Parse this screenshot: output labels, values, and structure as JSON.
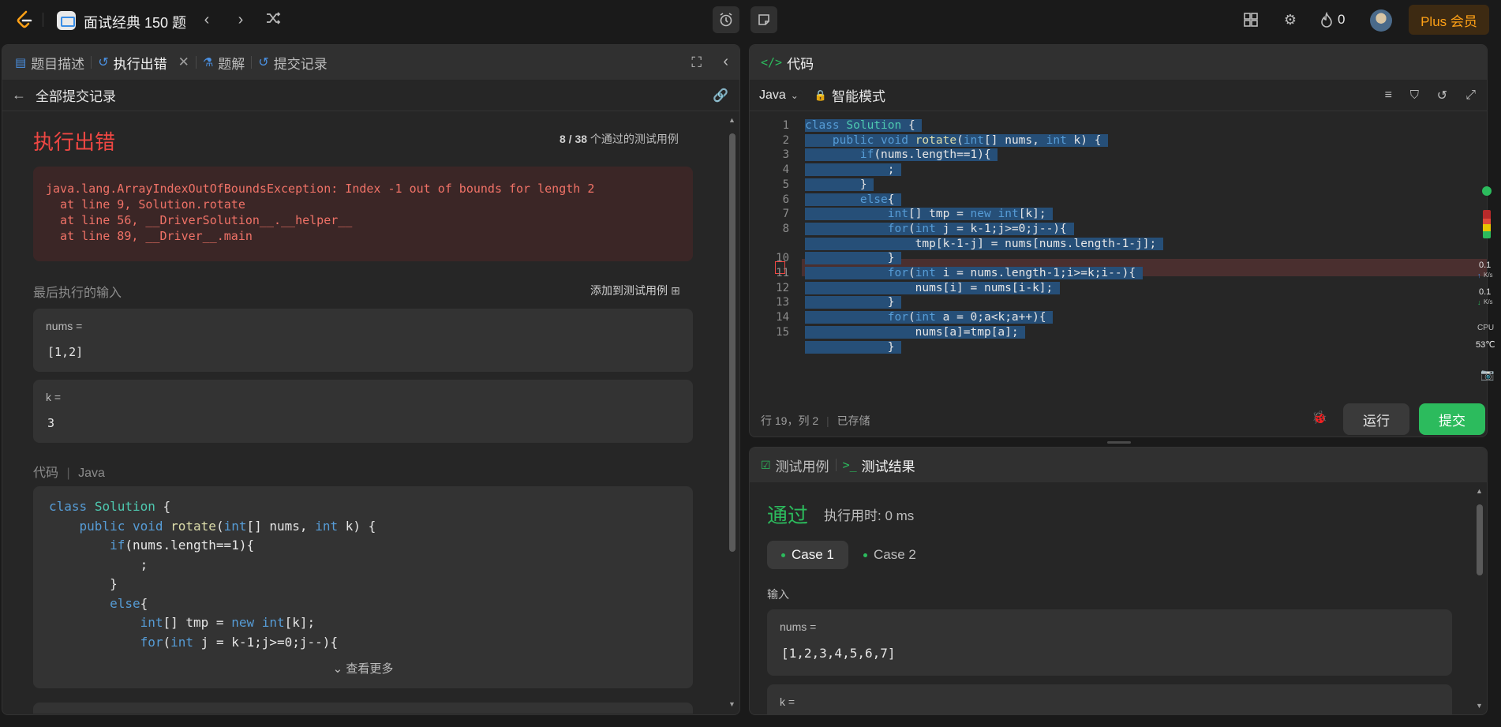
{
  "topbar": {
    "problem_list_title": "面试经典 150 题",
    "streak_count": "0",
    "plus_label": "Plus 会员"
  },
  "left_panel": {
    "tabs": [
      {
        "label": "题目描述",
        "icon": "description-icon"
      },
      {
        "label": "执行出错",
        "icon": "history-icon",
        "active": true
      },
      {
        "label": "题解",
        "icon": "flask-icon"
      },
      {
        "label": "提交记录",
        "icon": "history-icon"
      }
    ],
    "back_label": "全部提交记录",
    "status_title": "执行出错",
    "passed_count": "8 / 38",
    "passed_suffix": "个通过的测试用例",
    "error_message": "java.lang.ArrayIndexOutOfBoundsException: Index -1 out of bounds for length 2\n  at line 9, Solution.rotate\n  at line 56, __DriverSolution__.__helper__\n  at line 89, __Driver__.main",
    "last_input_label": "最后执行的输入",
    "add_testcase_label": "添加到测试用例",
    "inputs": [
      {
        "name": "nums =",
        "value": "[1,2]"
      },
      {
        "name": "k =",
        "value": "3"
      }
    ],
    "code_label": "代码",
    "code_lang": "Java",
    "see_more_label": "查看更多"
  },
  "editor": {
    "title": "代码",
    "language": "Java",
    "mode_label": "智能模式",
    "cursor_pos": "行 19，列 2",
    "save_status": "已存储",
    "run_label": "运行",
    "submit_label": "提交",
    "lines": [
      "class Solution {",
      "    public void rotate(int[] nums, int k) {",
      "        if(nums.length==1){",
      "            ;",
      "        }",
      "        else{",
      "            int[] tmp = new int[k];",
      "            for(int j = k-1;j>=0;j--){",
      "                tmp[k-1-j] = nums[nums.length-1-j];",
      "            }",
      "            for(int i = nums.length-1;i>=k;i--){",
      "                nums[i] = nums[i-k];",
      "            }",
      "            for(int a = 0;a<k;a++){",
      "                nums[a]=tmp[a];",
      "            }"
    ],
    "line_numbers": [
      "1",
      "2",
      "3",
      "4",
      "5",
      "6",
      "7",
      "8",
      "",
      "10",
      "11",
      "12",
      "13",
      "14",
      "15"
    ]
  },
  "results": {
    "tab_testcase": "测试用例",
    "tab_result": "测试结果",
    "verdict": "通过",
    "runtime": "执行用时: 0 ms",
    "cases": [
      "Case 1",
      "Case 2"
    ],
    "input_label": "输入",
    "inputs": [
      {
        "name": "nums =",
        "value": "[1,2,3,4,5,6,7]"
      },
      {
        "name": "k =",
        "value": ""
      }
    ]
  },
  "sidebar_monitor": {
    "up_speed": "0.1",
    "up_unit": "K/s",
    "down_speed": "0.1",
    "down_unit": "K/s",
    "cpu_label": "CPU",
    "temp": "53℃"
  },
  "colors": {
    "accent": "#ffa116",
    "error": "#ef4743",
    "success": "#2cbb5d",
    "selection": "#264f78"
  }
}
